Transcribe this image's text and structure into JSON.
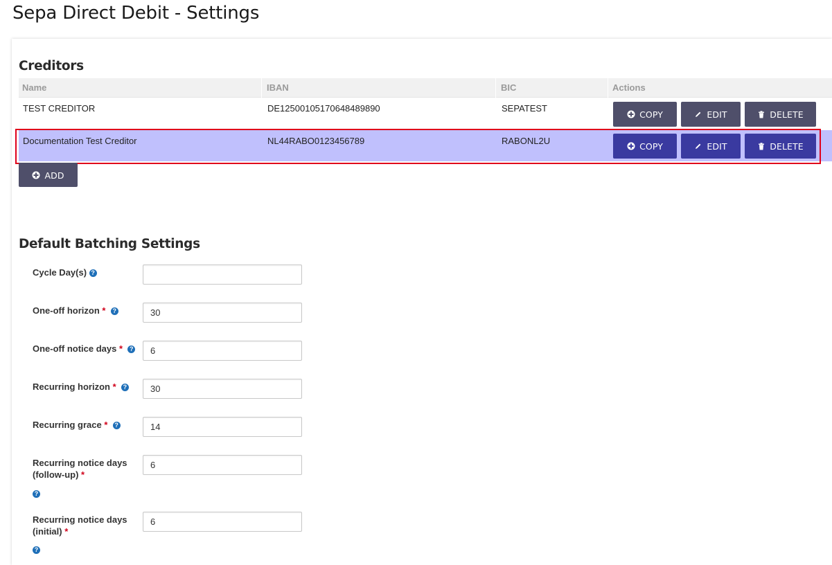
{
  "page": {
    "title": "Sepa Direct Debit - Settings"
  },
  "creditors": {
    "heading": "Creditors",
    "columns": [
      "Name",
      "IBAN",
      "BIC",
      "Actions"
    ],
    "rows": [
      {
        "name": "TEST CREDITOR",
        "iban": "DE12500105170648489890",
        "bic": "SEPATEST",
        "selected": false
      },
      {
        "name": "Documentation Test Creditor",
        "iban": "NL44RABO0123456789",
        "bic": "RABONL2U",
        "selected": true
      }
    ],
    "actions": {
      "copy": "COPY",
      "edit": "EDIT",
      "delete": "DELETE"
    },
    "add_label": "ADD"
  },
  "batching": {
    "heading": "Default Batching Settings",
    "fields": {
      "cycle_days": {
        "label": "Cycle Day(s)",
        "value": ""
      },
      "oneoff_horizon": {
        "label": "One-off horizon",
        "value": "30"
      },
      "oneoff_notice": {
        "label": "One-off notice days",
        "value": "6"
      },
      "recurring_horizon": {
        "label": "Recurring horizon",
        "value": "30"
      },
      "recurring_grace": {
        "label": "Recurring grace",
        "value": "14"
      },
      "recurring_notice_followup": {
        "label_line1": "Recurring notice days",
        "label_line2": "(follow-up)",
        "value": "6"
      },
      "recurring_notice_initial": {
        "label_line1": "Recurring notice days",
        "label_line2": "(initial)",
        "value": "6"
      }
    },
    "required_mark": "*",
    "help_glyph": "?"
  },
  "colors": {
    "selected_row": "#c0c0fd",
    "selected_outline": "#e0001b",
    "button_dark": "#4f4f6a",
    "button_blue": "#3a3aa0",
    "help_icon": "#1e6fb8",
    "required": "#d0021b"
  },
  "icons": {
    "copy": "plus-circle-icon",
    "edit": "pencil-icon",
    "delete": "trash-icon",
    "add": "plus-circle-icon",
    "help": "question-circle-icon"
  }
}
